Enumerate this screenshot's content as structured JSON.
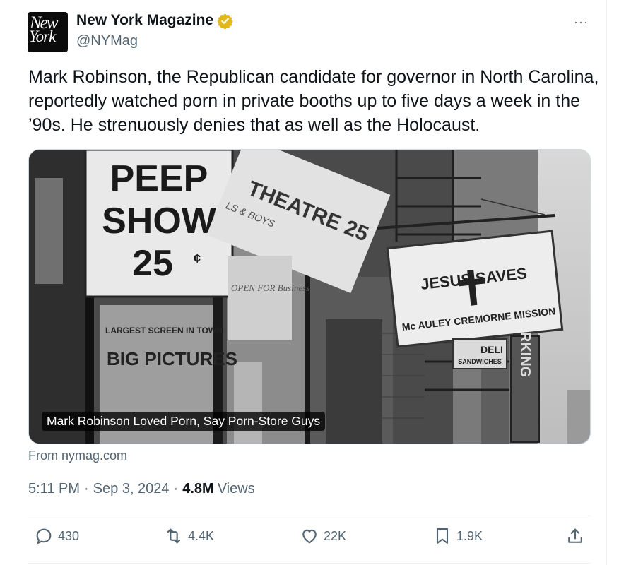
{
  "account": {
    "name": "New York Magazine",
    "handle": "@NYMag",
    "avatar_text_1": "New",
    "avatar_text_2": "York"
  },
  "more_label": "···",
  "tweet": {
    "text": "Mark Robinson, the Republican candidate for governor in North Carolina, reportedly watched porn in private booths up to five days a week in the ’90s. He strenuously denies that as well as the Holocaust."
  },
  "card": {
    "caption": "Mark Robinson Loved Porn, Say Porn-Store Guys",
    "source": "From nymag.com",
    "image_text": {
      "peep": "PEEP",
      "show": "SHOW",
      "price": "25",
      "cent": "¢",
      "theatre": "THEATRE 25",
      "boys": "LS & BOYS",
      "open": "OPEN FOR Business",
      "largest": "LARGEST SCREEN IN TOWN",
      "big_pictures": "BIG PICTURES",
      "jesus_saves": "JESUS SAVES",
      "mission": "Mc AULEY CREMORNE MISSION",
      "deli": "DELI",
      "sandwiches": "SANDWICHES",
      "parking": "RKING"
    }
  },
  "meta": {
    "time": "5:11 PM",
    "sep": "·",
    "date": "Sep 3, 2024",
    "views_count": "4.8M",
    "views_label": "Views"
  },
  "actions": {
    "replies": "430",
    "reposts": "4.4K",
    "likes": "22K",
    "bookmarks": "1.9K"
  },
  "colors": {
    "text": "#0f1419",
    "secondary": "#536471",
    "verified_gold": "#e2b719",
    "divider": "#eff3f4"
  }
}
